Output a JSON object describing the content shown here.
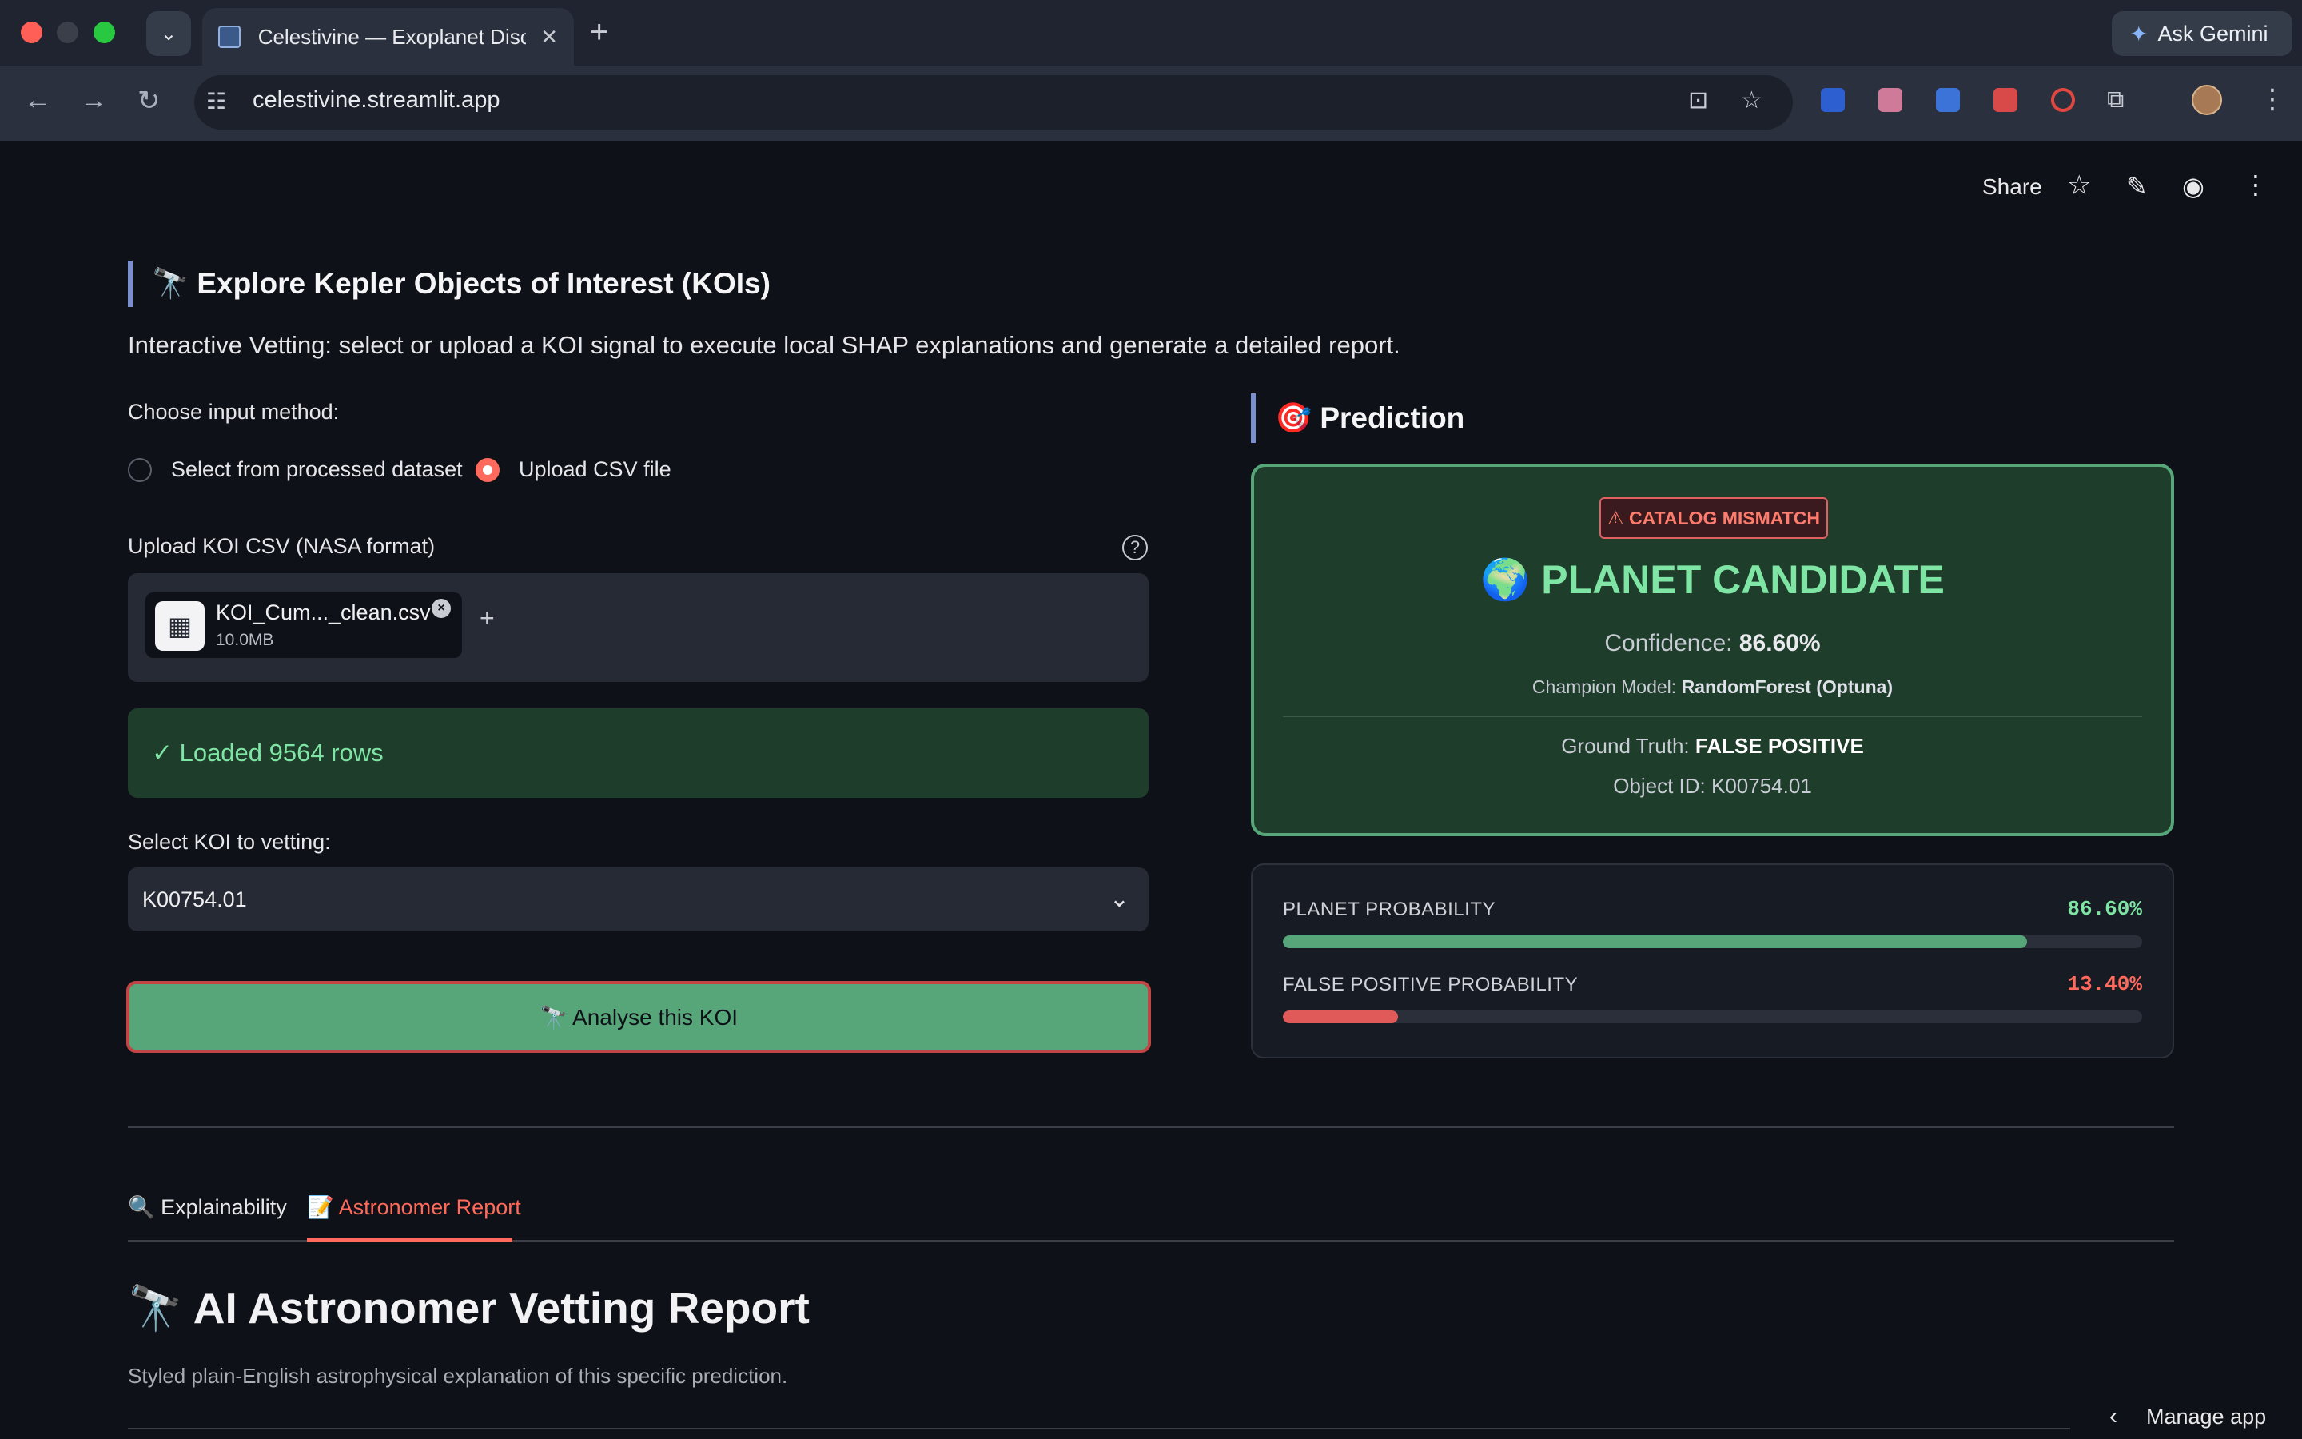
{
  "browser": {
    "tab_title": "Celestivine — Exoplanet Disco",
    "tab_close": "✕",
    "new_tab": "+",
    "gemini_label": "Ask Gemini",
    "url": "celestivine.streamlit.app"
  },
  "app_header": {
    "share_label": "Share",
    "star_icon": "☆",
    "edit_icon": "✎",
    "github_icon": "◉",
    "menu_icon": "⋮"
  },
  "explore": {
    "title": "🔭 Explore Kepler Objects of Interest (KOIs)",
    "subtitle": "Interactive Vetting: select or upload a KOI signal to execute local SHAP explanations and generate a detailed report.",
    "input_method_label": "Choose input method:",
    "radio_options": [
      "Select from processed dataset",
      "Upload CSV file"
    ],
    "radio_selected": "Upload CSV file",
    "upload_label": "Upload KOI CSV (NASA format)",
    "file_name": "KOI_Cum..._clean.csv",
    "file_size": "10.0MB",
    "success_message": "✓ Loaded 9564 rows",
    "select_label": "Select KOI to vetting:",
    "select_value": "K00754.01",
    "analyse_button": "🔭 Analyse this KOI"
  },
  "prediction": {
    "title": "🎯 Prediction",
    "badge": "⚠ CATALOG MISMATCH",
    "verdict": "🌍 PLANET CANDIDATE",
    "confidence_label": "Confidence:",
    "confidence_value": "86.60%",
    "champion_label": "Champion Model:",
    "champion_value": "RandomForest (Optuna)",
    "truth_label": "Ground Truth:",
    "truth_value": "FALSE POSITIVE",
    "object_id": "Object ID: K00754.01",
    "planet_prob_label": "PLANET PROBABILITY",
    "planet_prob_value": "86.60%",
    "planet_prob_fraction": 0.866,
    "fp_prob_label": "FALSE POSITIVE PROBABILITY",
    "fp_prob_value": "13.40%",
    "fp_prob_fraction": 0.134
  },
  "colors": {
    "planet_bar": "#56a679",
    "fp_bar": "#e05a5a",
    "accent": "#ff6a5c"
  },
  "tabs": [
    {
      "label": "🔍 Explainability"
    },
    {
      "label": "📝 Astronomer Report"
    }
  ],
  "report": {
    "title": "🔭 AI Astronomer Vetting Report",
    "subtitle": "Styled plain-English astrophysical explanation of this specific prediction."
  },
  "manage_app_label": "Manage app"
}
